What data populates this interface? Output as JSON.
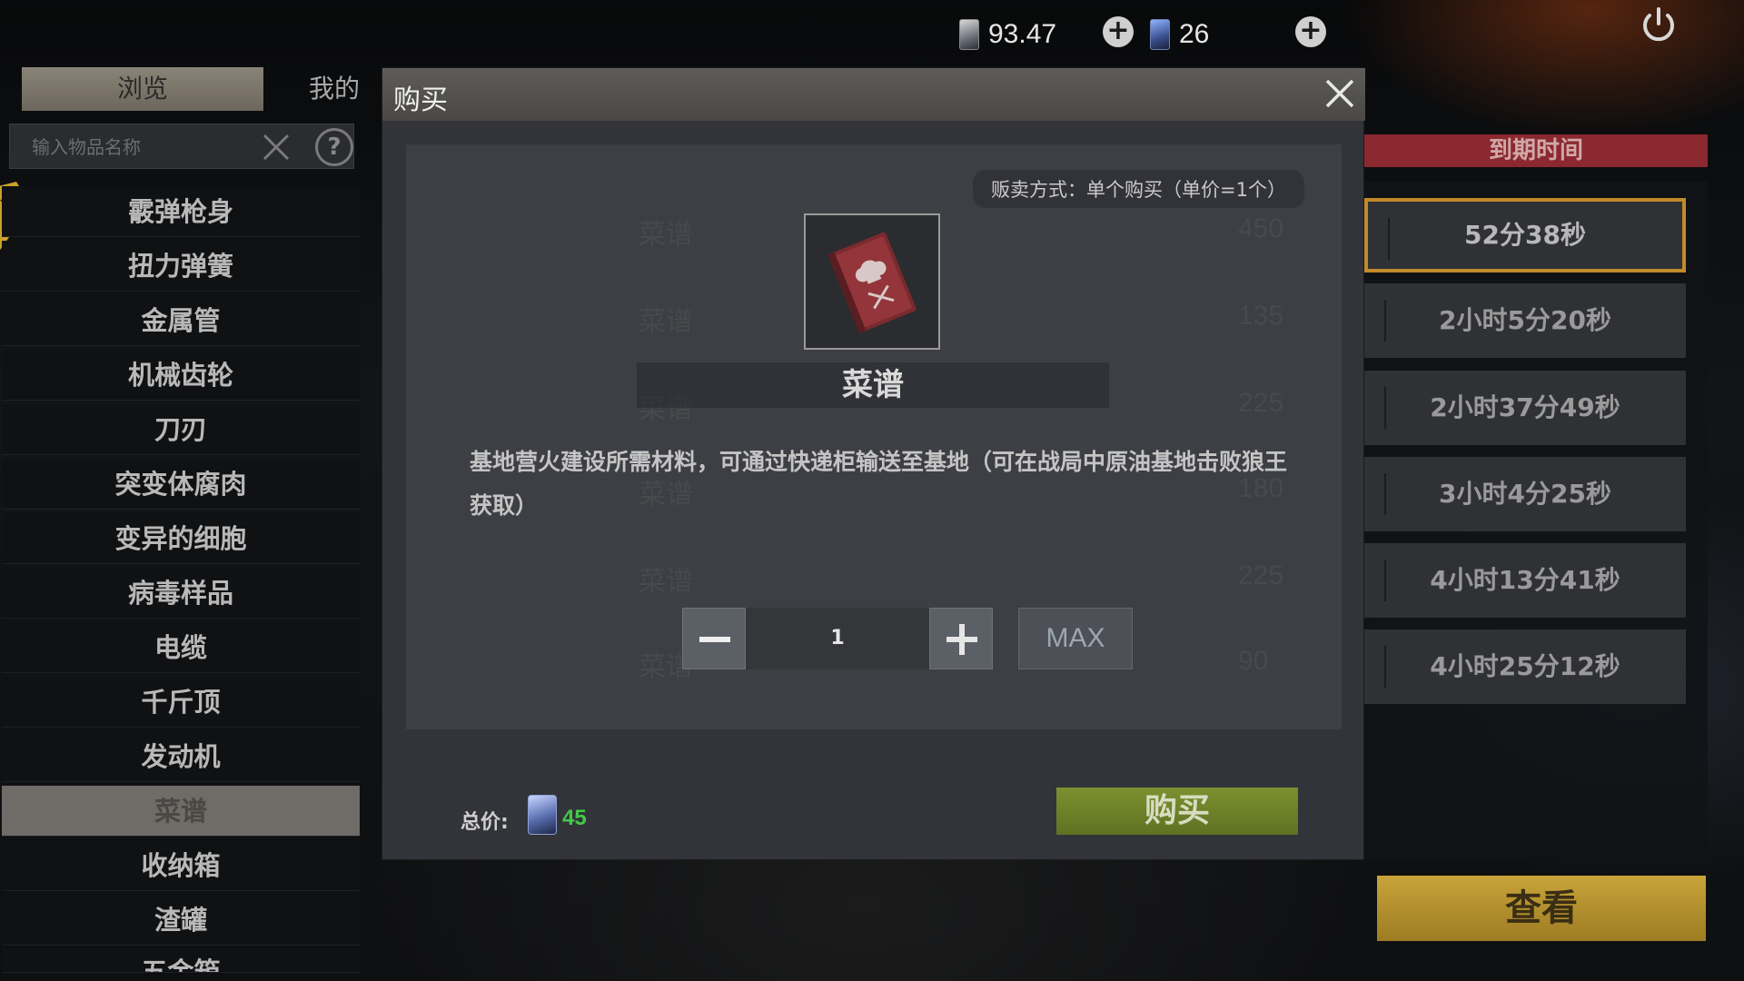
{
  "topbar": {
    "currency1_value": "93.47",
    "currency2_value": "26",
    "plus_symbol": "+"
  },
  "left": {
    "tabs": [
      {
        "label": "浏览"
      },
      {
        "label": "我的"
      }
    ],
    "search": {
      "placeholder": "输入物品名称",
      "help_symbol": "?"
    },
    "items": [
      {
        "label": "霰弹枪身"
      },
      {
        "label": "扭力弹簧"
      },
      {
        "label": "金属管"
      },
      {
        "label": "机械齿轮"
      },
      {
        "label": "刀刃"
      },
      {
        "label": "突变体腐肉"
      },
      {
        "label": "变异的细胞"
      },
      {
        "label": "病毒样品"
      },
      {
        "label": "电缆"
      },
      {
        "label": "千斤顶"
      },
      {
        "label": "发动机"
      },
      {
        "label": "菜谱"
      },
      {
        "label": "收纳箱"
      },
      {
        "label": "渣罐"
      },
      {
        "label": "五金箱"
      }
    ]
  },
  "right": {
    "header": "到期时间",
    "times": [
      "52分38秒",
      "2小时5分20秒",
      "2小时37分49秒",
      "3小时4分25秒",
      "4小时13分41秒",
      "4小时25分12秒"
    ],
    "view_button": "查看"
  },
  "modal": {
    "title": "购买",
    "sale_mode": "贩卖方式：单个购买（单价=1个）",
    "item_name": "菜谱",
    "description": "基地营火建设所需材料，可通过快递柜输送至基地（可在战局中原油基地击败狼王获取）",
    "quantity": "1",
    "max_label": "MAX",
    "total_label": "总价:",
    "total_value": "45",
    "buy_label": "购买",
    "background_rows": [
      {
        "name": "菜谱",
        "price": "450"
      },
      {
        "name": "菜谱",
        "price": "135"
      },
      {
        "name": "菜谱",
        "price": "225"
      },
      {
        "name": "菜谱",
        "price": "180"
      },
      {
        "name": "菜谱",
        "price": "225"
      },
      {
        "name": "菜谱",
        "price": "90"
      }
    ]
  },
  "colors": {
    "selected_border": "#c28a2a",
    "header_red": "#8b2830",
    "buy_green": "#7c9030",
    "total_green": "#44c94a",
    "view_gold": "#c9a43a"
  }
}
